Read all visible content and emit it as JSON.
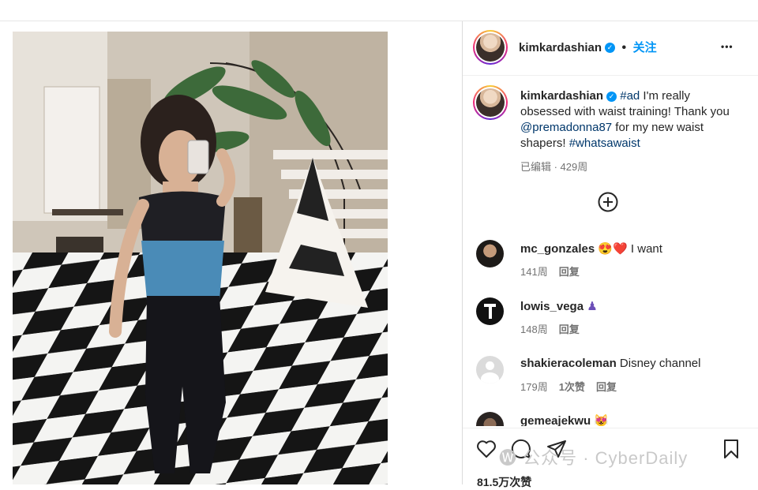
{
  "post": {
    "author": "kimkardashian",
    "verified_mark": "✓",
    "separator": "•",
    "follow_label": "关注",
    "more_label": "•••"
  },
  "caption": {
    "author": "kimkardashian",
    "hashtag1": "#ad",
    "text1": " I'm really obsessed with waist training! Thank you ",
    "mention": "@premadonna87",
    "text2": " for my new waist shapers! ",
    "hashtag2": "#whatsawaist",
    "meta": "已编辑 · 429周"
  },
  "load_more_icon": "plus-circle-icon",
  "comments": [
    {
      "user": "mc_gonzales",
      "text": " 😍❤️ I want",
      "time": "141周",
      "reply": "回复"
    },
    {
      "user": "lowis_vega",
      "text": " ♟",
      "time": "148周",
      "reply": "回复"
    },
    {
      "user": "shakieracoleman",
      "text": " Disney channel",
      "time": "179周",
      "likes": "1次赞",
      "reply": "回复"
    },
    {
      "user": "gemeajekwu",
      "text": " 😻"
    }
  ],
  "actions": {
    "like_icon": "heart-icon",
    "comment_icon": "comment-icon",
    "share_icon": "send-icon",
    "save_icon": "bookmark-icon",
    "likes_count": "81.5万次赞"
  },
  "watermark": "🅦 公众号 · CyberDaily",
  "colors": {
    "accent": "#0095f6",
    "link": "#00376b",
    "muted": "#737373"
  }
}
